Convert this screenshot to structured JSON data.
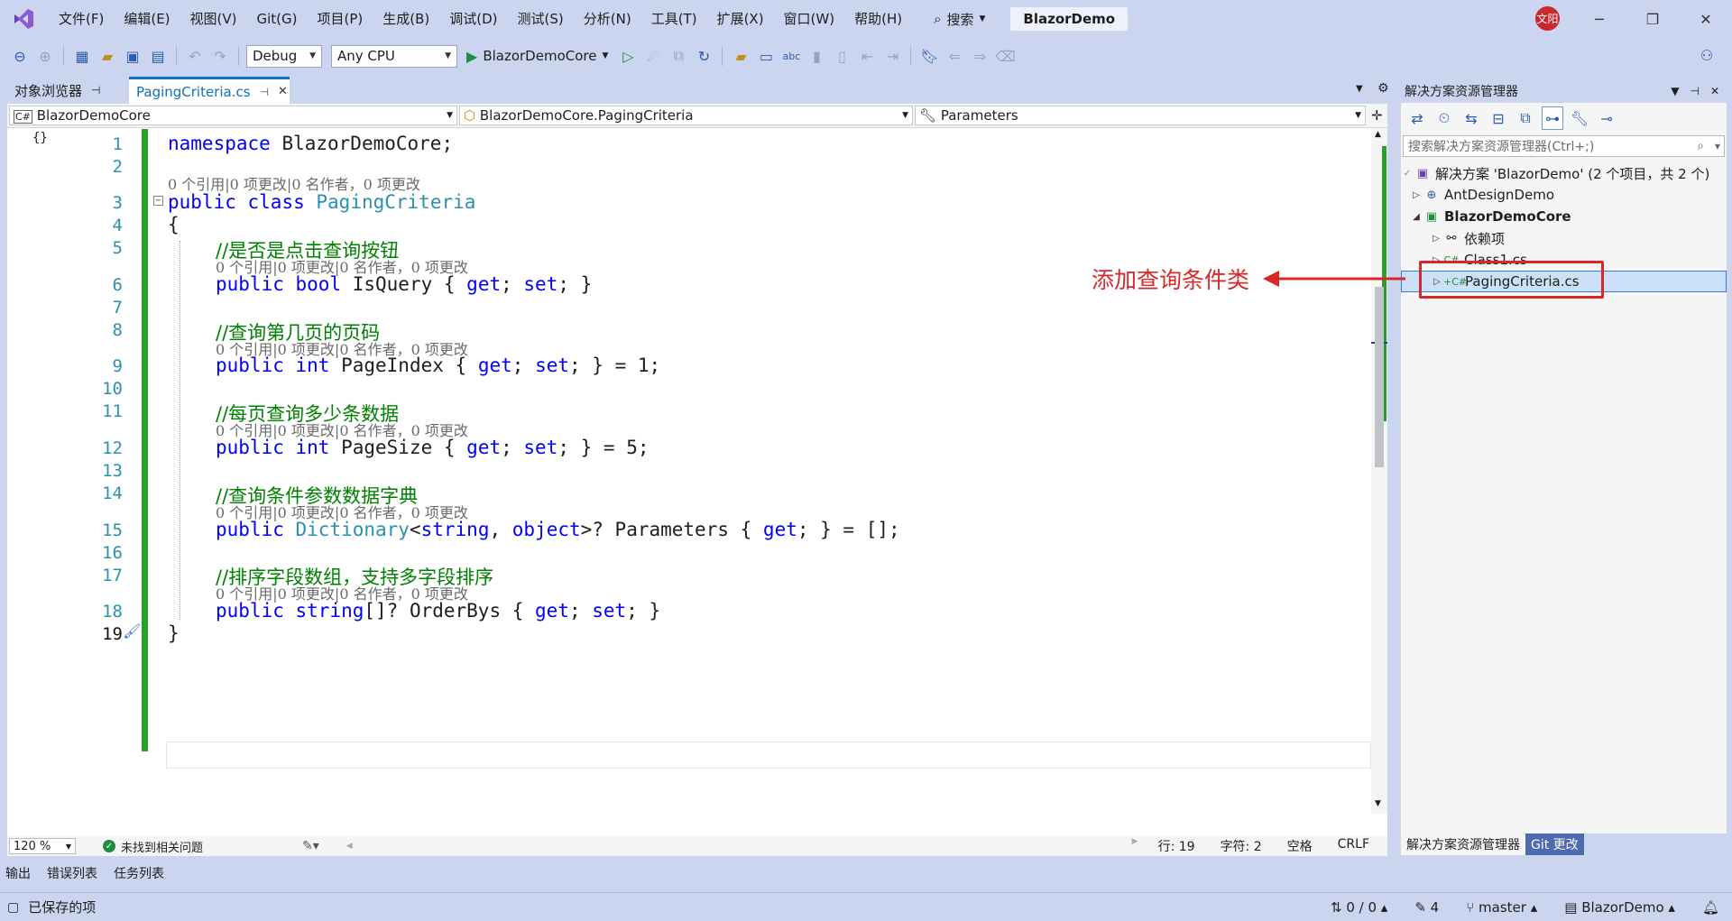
{
  "menubar": {
    "items": [
      "文件(F)",
      "编辑(E)",
      "视图(V)",
      "Git(G)",
      "项目(P)",
      "生成(B)",
      "调试(D)",
      "测试(S)",
      "分析(N)",
      "工具(T)",
      "扩展(X)",
      "窗口(W)",
      "帮助(H)"
    ],
    "search_label": "搜索",
    "solution_title": "BlazorDemo",
    "avatar_text": "文阳"
  },
  "toolbar": {
    "config": "Debug",
    "platform": "Any CPU",
    "run_target": "BlazorDemoCore"
  },
  "tabs": [
    {
      "label": "对象浏览器"
    },
    {
      "label": "PagingCriteria.cs"
    }
  ],
  "navbar": {
    "project": "BlazorDemoCore",
    "type": "BlazorDemoCore.PagingCriteria",
    "member": "Parameters"
  },
  "editor": {
    "lens": "0 个引用|0 项更改|0 名作者，0 项更改",
    "line_numbers": [
      "1",
      "2",
      "3",
      "4",
      "5",
      "6",
      "7",
      "8",
      "9",
      "10",
      "11",
      "12",
      "13",
      "14",
      "15",
      "16",
      "17",
      "18",
      "19"
    ]
  },
  "status": {
    "zoom": "120 %",
    "issues": "未找到相关问题",
    "line": "行: 19",
    "char": "字符: 2",
    "spacing": "空格",
    "eol": "CRLF"
  },
  "bottom_tabs": [
    "输出",
    "错误列表",
    "任务列表"
  ],
  "statusbar": {
    "saved": "已保存的项",
    "changes": "0 / 0",
    "commits": "4",
    "branch": "master",
    "repo": "BlazorDemo"
  },
  "solution_explorer": {
    "title": "解决方案资源管理器",
    "search_placeholder": "搜索解决方案资源管理器(Ctrl+;)",
    "tree": [
      {
        "label": "解决方案 'BlazorDemo' (2 个项目，共 2 个)"
      },
      {
        "label": "AntDesignDemo"
      },
      {
        "label": "BlazorDemoCore"
      },
      {
        "label": "依赖项"
      },
      {
        "label": "Class1.cs"
      },
      {
        "label": "PagingCriteria.cs"
      }
    ],
    "tabs": [
      "解决方案资源管理器",
      "Git 更改"
    ]
  },
  "annotation": {
    "text": "添加查询条件类",
    "color": "#d7282a"
  }
}
